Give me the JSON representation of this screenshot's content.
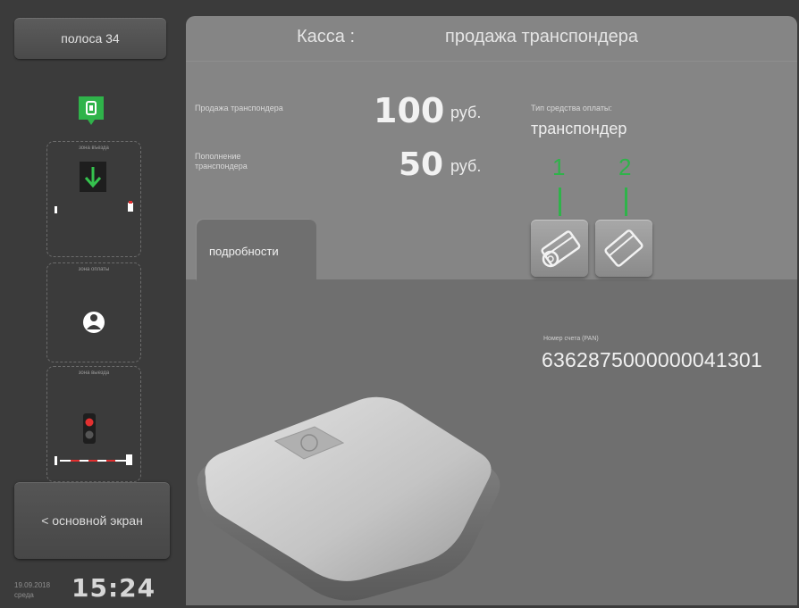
{
  "sidebar": {
    "lane_button": "полоса 34",
    "zones": [
      {
        "label": "зона въезда"
      },
      {
        "label": "зона оплаты"
      },
      {
        "label": "зона выезда"
      }
    ],
    "home_button": "< основной экран",
    "date": "19.09.2018",
    "weekday": "среда",
    "time": "15:24"
  },
  "main": {
    "title_left": "Касса :",
    "title_right": "продажа транспондера",
    "sale_label": "Продажа транспондера",
    "sale_value": "100",
    "sale_unit": "руб.",
    "topup_label": "Пополнение транспондера",
    "topup_value": "50",
    "topup_unit": "руб.",
    "pay_type_label": "Тип средства оплаты:",
    "pay_type_value": "транспондер",
    "method_numbers": [
      "1",
      "2"
    ],
    "methods": [
      {
        "icon": "card-with-coin-icon"
      },
      {
        "icon": "card-icon"
      }
    ],
    "tab_label": "подробности",
    "pan_label": "Номер счета (PAN)",
    "pan_value": "6362875000000041301"
  },
  "colors": {
    "background": "#3b3b3b",
    "panel": "#858585",
    "tab_panel": "#6f6f6f",
    "accent_green": "#2fb34a",
    "signal_red": "#e23030"
  }
}
